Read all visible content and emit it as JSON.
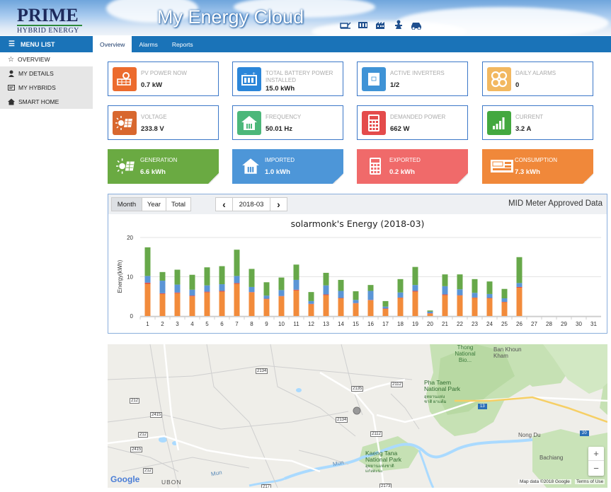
{
  "header": {
    "logo_main": "PRIME",
    "logo_sub": "HYBRID ENERGY",
    "app_title": "My Energy Cloud",
    "icons": [
      "solar-panel-icon",
      "battery-icon",
      "factory-icon",
      "tower-icon",
      "car-icon"
    ]
  },
  "sidebar": {
    "menu_title": "MENU LIST",
    "items": [
      {
        "label": "OVERVIEW",
        "icon": "star-icon"
      },
      {
        "label": "MY DETAILS",
        "icon": "user-icon"
      },
      {
        "label": "MY HYBRIDS",
        "icon": "inverter-icon"
      },
      {
        "label": "SMART HOME",
        "icon": "home-icon"
      }
    ]
  },
  "tabs": [
    {
      "label": "Overview"
    },
    {
      "label": "Alarms"
    },
    {
      "label": "Reports"
    }
  ],
  "cards": [
    {
      "label": "PV POWER NOW",
      "value": "0.7 kW",
      "color": "#ec6b2d",
      "icon": "solar-panel-icon"
    },
    {
      "label": "TOTAL BATTERY POWER INSTALLED",
      "value": "15.0 kWh",
      "color": "#2b86d9",
      "icon": "battery-icon"
    },
    {
      "label": "ACTIVE INVERTERS",
      "value": "1/2",
      "color": "#3f93d6",
      "icon": "inverter-icon"
    },
    {
      "label": "DAILY ALARMS",
      "value": "0",
      "color": "#f2b860",
      "icon": "alarm-icon"
    },
    {
      "label": "VOLTAGE",
      "value": "233.8 V",
      "color": "#d8672e",
      "icon": "sun-panel-icon"
    },
    {
      "label": "FREQUENCY",
      "value": "50.01 Hz",
      "color": "#4cb77a",
      "icon": "house-icon"
    },
    {
      "label": "DEMANDED POWER",
      "value": "662 W",
      "color": "#e44b4b",
      "icon": "calculator-icon"
    },
    {
      "label": "CURRENT",
      "value": "3.2 A",
      "color": "#43a83f",
      "icon": "signal-bars-icon"
    }
  ],
  "energy_cards": [
    {
      "label": "GENERATION",
      "value": "6.6 kWh",
      "color": "#6aaa42",
      "icon": "sun-panel-icon"
    },
    {
      "label": "IMPORTED",
      "value": "1.0 kWh",
      "color": "#4d96d8",
      "icon": "house-icon"
    },
    {
      "label": "EXPORTED",
      "value": "0.2 kWh",
      "color": "#f06a6a",
      "icon": "calculator-icon"
    },
    {
      "label": "CONSUMPTION",
      "value": "7.3 kWh",
      "color": "#f0883a",
      "icon": "meter-icon"
    }
  ],
  "chart_controls": {
    "month": "Month",
    "year": "Year",
    "total": "Total",
    "prev": "‹",
    "next": "›",
    "period": "2018-03",
    "mid_label": "MID Meter Approved Data"
  },
  "chart_data": {
    "type": "bar",
    "title": "solarmonk's Energy (2018-03)",
    "ylabel": "Energy(kWh)",
    "xlabel": "",
    "ylim": [
      0,
      20
    ],
    "yticks": [
      0,
      10,
      20
    ],
    "stacked": true,
    "categories": [
      "1",
      "2",
      "3",
      "4",
      "5",
      "6",
      "7",
      "8",
      "9",
      "10",
      "11",
      "12",
      "13",
      "14",
      "15",
      "16",
      "17",
      "18",
      "19",
      "20",
      "21",
      "22",
      "23",
      "24",
      "25",
      "26",
      "27",
      "28",
      "29",
      "30",
      "31"
    ],
    "series": [
      {
        "color": "#f28b3b",
        "values": [
          8.2,
          5.6,
          5.8,
          5.0,
          6.0,
          6.2,
          8.2,
          6.0,
          4.3,
          5.0,
          6.5,
          3.0,
          5.3,
          4.5,
          3.2,
          4.0,
          1.8,
          4.6,
          6.2,
          0.6,
          5.3,
          5.2,
          4.6,
          4.5,
          3.5,
          7.2,
          0,
          0,
          0,
          0,
          0
        ]
      },
      {
        "color": "#d94d4d",
        "values": [
          0.3,
          0.2,
          0.2,
          0.2,
          0.2,
          0.2,
          0.2,
          0.1,
          0.1,
          0.1,
          0.2,
          0.1,
          0.2,
          0.1,
          0.1,
          0.1,
          0.1,
          0.1,
          0.2,
          0.1,
          0.2,
          0.1,
          0.1,
          0.1,
          0.1,
          0.2,
          0,
          0,
          0,
          0,
          0
        ]
      },
      {
        "color": "#5b95d6",
        "values": [
          1.7,
          3.2,
          2.0,
          1.5,
          1.6,
          1.7,
          1.8,
          1.3,
          0.8,
          1.5,
          2.5,
          0.7,
          2.3,
          1.8,
          0.8,
          2.3,
          0.5,
          1.3,
          1.5,
          0.4,
          2.1,
          1.5,
          1.2,
          1.0,
          0.9,
          1.0,
          0,
          0,
          0,
          0,
          0
        ]
      },
      {
        "color": "#67a84a",
        "values": [
          7.3,
          2.2,
          3.8,
          3.8,
          4.6,
          4.6,
          6.7,
          4.6,
          3.4,
          3.2,
          3.9,
          2.3,
          3.2,
          2.8,
          2.2,
          1.5,
          1.4,
          3.4,
          4.6,
          0.3,
          3.0,
          3.8,
          3.5,
          3.2,
          2.4,
          6.6,
          0,
          0,
          0,
          0,
          0
        ]
      }
    ]
  },
  "map": {
    "labels": [
      {
        "text": "Thong National Bio..."
      },
      {
        "text": "Ban Khoun Kham"
      },
      {
        "text": "Pha Taem National Park"
      },
      {
        "text": "อุทยานแห่งชาติ ผาแต้ม"
      },
      {
        "text": "Nong Du"
      },
      {
        "text": "Kaeng Tana National Park"
      },
      {
        "text": "อุทยานแห่งชาติ แก่งตะนะ"
      },
      {
        "text": "UBON"
      },
      {
        "text": "Bachiang"
      },
      {
        "text": "Mun"
      },
      {
        "text": "Mun"
      }
    ],
    "road_numbers": [
      "2134",
      "2135",
      "2112",
      "212",
      "2415",
      "2134",
      "2112",
      "212",
      "2415",
      "212",
      "217",
      "2173",
      "13",
      "20",
      "2134"
    ],
    "google_logo": "Google",
    "attribution": "Map data ©2018 Google",
    "terms": "Terms of Use",
    "zoom_in": "+",
    "zoom_out": "−"
  }
}
